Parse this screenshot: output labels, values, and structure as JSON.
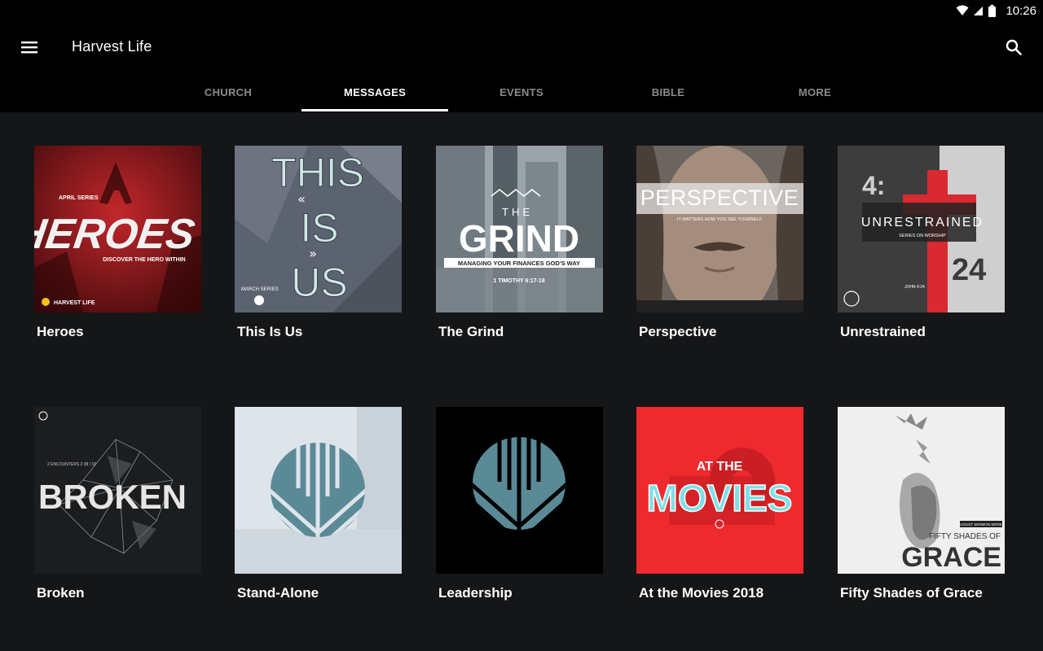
{
  "status": {
    "time": "10:26"
  },
  "app": {
    "title": "Harvest Life"
  },
  "tabs": [
    {
      "label": "CHURCH",
      "active": false
    },
    {
      "label": "MESSAGES",
      "active": true
    },
    {
      "label": "EVENTS",
      "active": false
    },
    {
      "label": "BIBLE",
      "active": false
    },
    {
      "label": "MORE",
      "active": false
    }
  ],
  "cards": [
    {
      "title": "Heroes",
      "art": {
        "top": "APRIL SERIES",
        "main": "HEROES",
        "sub": "DISCOVER THE HERO WITHIN",
        "brand": "HARVEST LIFE"
      }
    },
    {
      "title": "This Is Us",
      "art": {
        "line1": "THIS",
        "line2": "IS",
        "line3": "US",
        "tag": "MARCH SERIES"
      }
    },
    {
      "title": "The Grind",
      "art": {
        "the": "THE",
        "main": "GRIND",
        "sub": "MANAGING YOUR FINANCES GOD'S WAY",
        "ref": "1 TIMOTHY 6:17-18"
      }
    },
    {
      "title": "Perspective",
      "art": {
        "main": "PERSPECTIVE",
        "sub": "IT MATTERS HOW YOU SEE YOURSELF"
      }
    },
    {
      "title": "Unrestrained",
      "art": {
        "main": "UNRESTRAINED",
        "sub": "SERIES ON WORSHIP",
        "num1": "4:",
        "num2": "24",
        "ref": "JOHN 4:24"
      }
    },
    {
      "title": "Broken",
      "art": {
        "main": "BROKEN",
        "sub": "2 ENCOUNTERS 2:38 | 18"
      }
    },
    {
      "title": "Stand-Alone",
      "art": {}
    },
    {
      "title": "Leadership",
      "art": {}
    },
    {
      "title": "At the Movies 2018",
      "art": {
        "top": "AT THE",
        "main": "MOVIES"
      }
    },
    {
      "title": "Fifty Shades of Grace",
      "art": {
        "tag": "AUGUST SERMON SERIES",
        "line1": "FIFTY SHADES OF",
        "main": "GRACE"
      }
    }
  ],
  "colors": {
    "accent": "#ffffff",
    "inactive_tab": "#8a8a8a",
    "background": "#151618",
    "bar": "#000000"
  }
}
